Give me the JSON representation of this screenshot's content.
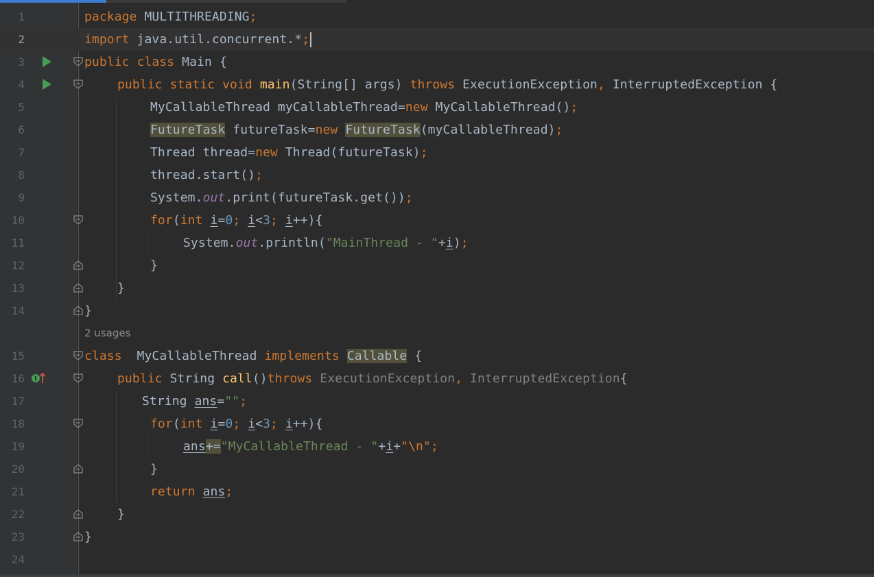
{
  "editor": {
    "current_line": 2,
    "usages_hint": "2 usages",
    "line_numbers": [
      "1",
      "2",
      "3",
      "4",
      "5",
      "6",
      "7",
      "8",
      "9",
      "10",
      "11",
      "12",
      "13",
      "14",
      "15",
      "16",
      "17",
      "18",
      "19",
      "20",
      "21",
      "22",
      "23",
      "24"
    ]
  },
  "colors": {
    "background": "#2b2b2b",
    "keyword": "#cc7832",
    "method": "#ffc66d",
    "string": "#6a8759",
    "number": "#6897bb",
    "static_field": "#9876aa",
    "plain": "#a9b7c6"
  },
  "lines": {
    "l1": [
      "package",
      " MULTITHREADING",
      ";"
    ],
    "l2": [
      "import",
      " java.util.concurrent.*",
      ";"
    ],
    "l3": [
      "public",
      " ",
      "class",
      " Main {"
    ],
    "l4": [
      "public",
      " ",
      "static",
      " ",
      "void",
      " ",
      "main",
      "(String[] args) ",
      "throws",
      " ExecutionException",
      ",",
      " InterruptedException {"
    ],
    "l5": [
      "MyCallableThread myCallableThread=",
      "new",
      " MyCallableThread()",
      ";"
    ],
    "l6": [
      "FutureTask",
      " futureTask=",
      "new",
      " ",
      "FutureTask",
      "(myCallableThread)",
      ";"
    ],
    "l7": [
      "Thread thread=",
      "new",
      " Thread(futureTask)",
      ";"
    ],
    "l8": [
      "thread.start()",
      ";"
    ],
    "l9": [
      "System.",
      "out",
      ".print(futureTask.get())",
      ";"
    ],
    "l10": [
      "for",
      "(",
      "int",
      " ",
      "i",
      "=",
      "0",
      "; ",
      "i",
      "<",
      "3",
      "; ",
      "i",
      "++){"
    ],
    "l11": [
      "System.",
      "out",
      ".println(",
      "\"MainThread - \"",
      "+",
      "i",
      ")",
      ";"
    ],
    "l12": [
      "}"
    ],
    "l13": [
      "}"
    ],
    "l14": [
      "}"
    ],
    "l15": [
      "class",
      "  MyCallableThread ",
      "implements",
      " ",
      "Callable",
      " {"
    ],
    "l16": [
      "public",
      " String ",
      "call",
      "()",
      "throws",
      " ExecutionException",
      ",",
      " InterruptedException",
      "{"
    ],
    "l17": [
      "String ",
      "ans",
      "=",
      "\"\"",
      ";"
    ],
    "l18": [
      "for",
      "(",
      "int",
      " ",
      "i",
      "=",
      "0",
      "; ",
      "i",
      "<",
      "3",
      "; ",
      "i",
      "++){"
    ],
    "l19": [
      "ans",
      "+=",
      "\"MyCallableThread - \"",
      "+",
      "i",
      "+",
      "\"\\n\"",
      ";"
    ],
    "l20": [
      "}"
    ],
    "l21": [
      "return",
      " ",
      "ans",
      ";"
    ],
    "l22": [
      "}"
    ],
    "l23": [
      "}"
    ]
  },
  "gutter_icons": {
    "run": "run-play-icon",
    "fold": "fold-marker-icon",
    "implements": "implements-method-icon"
  }
}
